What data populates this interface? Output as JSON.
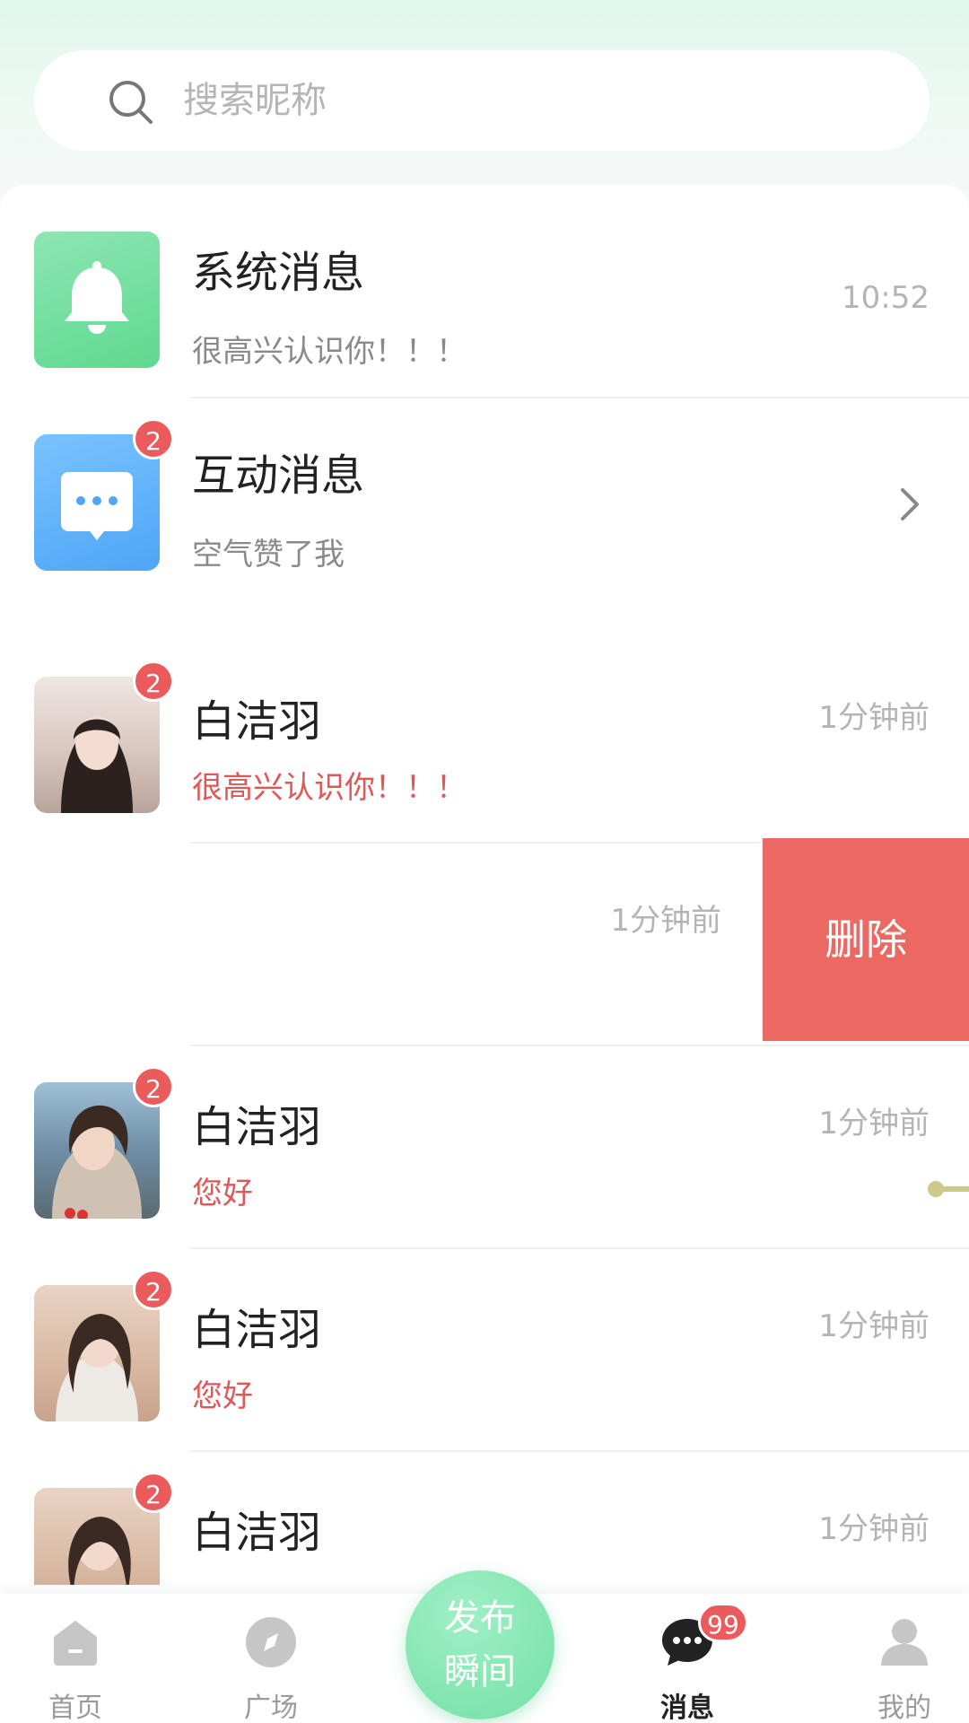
{
  "search": {
    "placeholder": "搜索昵称"
  },
  "system_message": {
    "title": "系统消息",
    "preview": "很高兴认识你！！！",
    "time": "10:52"
  },
  "interactive_message": {
    "title": "互动消息",
    "preview": "空气赞了我",
    "badge": "2"
  },
  "conversations": [
    {
      "name": "白洁羽",
      "preview": "很高兴认识你！！！",
      "time": "1分钟前",
      "badge": "2"
    },
    {
      "name": "",
      "preview": "",
      "time": "1分钟前",
      "badge": ""
    },
    {
      "name": "白洁羽",
      "preview": "您好",
      "time": "1分钟前",
      "badge": "2"
    },
    {
      "name": "白洁羽",
      "preview": "您好",
      "time": "1分钟前",
      "badge": "2"
    },
    {
      "name": "白洁羽",
      "preview": "",
      "time": "1分钟前",
      "badge": "2"
    }
  ],
  "delete_action": {
    "label": "删除"
  },
  "tabbar": {
    "home": "首页",
    "square": "广场",
    "publish_line1": "发布",
    "publish_line2": "瞬间",
    "messages": "消息",
    "messages_badge": "99",
    "mine": "我的"
  },
  "colors": {
    "accent_green": "#74e0a5",
    "badge_red": "#ec5b5b",
    "delete_red": "#ec6863",
    "preview_red": "#e15757"
  }
}
